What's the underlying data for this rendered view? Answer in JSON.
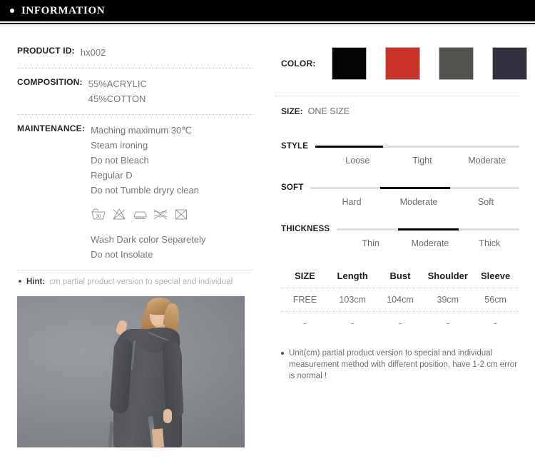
{
  "header": {
    "title": "INFORMATION",
    "bullet_icon": "bullet-dot"
  },
  "left": {
    "product_id": {
      "label": "PRODUCT ID:",
      "value": "hx002"
    },
    "composition": {
      "label": "COMPOSITION:",
      "lines": [
        "55%ACRYLIC",
        "45%COTTON"
      ]
    },
    "maintenance": {
      "label": "MAINTENANCE:",
      "lines": [
        "Maching maximum 30℃",
        "Steam ironing",
        "Do not Bleach",
        "Regular D",
        "Do not Tumble dryry clean"
      ],
      "care_symbols": [
        "wash-tub-30-icon",
        "do-not-bleach-icon",
        "iron-icon",
        "do-not-wring-icon",
        "do-not-tumble-dry-icon"
      ],
      "footer_lines": [
        "Wash Dark color Separetely",
        "Do not Insolate"
      ]
    },
    "hint": {
      "label": "Hint:",
      "text": "cm partial product version to special and individual"
    },
    "photo_alt": "model-wearing-gray-hooded-dress"
  },
  "right": {
    "color": {
      "label": "COLOR:",
      "swatches": [
        {
          "name": "black",
          "hex": "#050505"
        },
        {
          "name": "red",
          "hex": "#cc3328"
        },
        {
          "name": "dark-gray",
          "hex": "#51534f"
        },
        {
          "name": "dark-navy",
          "hex": "#31303f"
        }
      ]
    },
    "size": {
      "label": "SIZE:",
      "value": "ONE SIZE"
    },
    "attributes": [
      {
        "name": "STYLE",
        "options": [
          "Loose",
          "Tight",
          "Moderate"
        ],
        "selected_index": 0
      },
      {
        "name": "SOFT",
        "options": [
          "Hard",
          "Moderate",
          "Soft"
        ],
        "selected_index": 1
      },
      {
        "name": "THICKNESS",
        "options": [
          "Thin",
          "Moderate",
          "Thick"
        ],
        "selected_index": 1
      }
    ],
    "size_table": {
      "headers": [
        "SIZE",
        "Length",
        "Bust",
        "Shoulder",
        "Sleeve"
      ],
      "rows": [
        [
          "FREE",
          "103cm",
          "104cm",
          "39cm",
          "56cm"
        ],
        [
          "-",
          "-",
          "-",
          "-",
          "-"
        ]
      ]
    },
    "unit_note": "Unit(cm) partial product version to special and individual measurement method with different position, have 1-2 cm error is normal !"
  }
}
